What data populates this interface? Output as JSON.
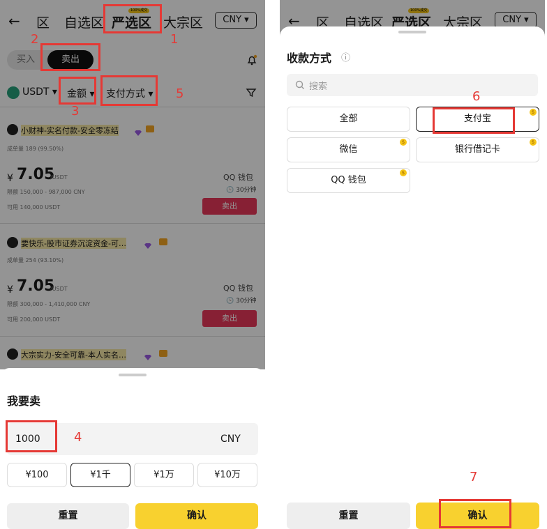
{
  "left": {
    "header": {
      "back": "←",
      "tab_partial": "区",
      "tab_self": "自选区",
      "tab_strict": "严选区",
      "tab_strict_badge": "100%成交",
      "tab_bulk": "大宗区",
      "currency": "CNY ▾"
    },
    "side": {
      "buy": "买入",
      "sell": "卖出"
    },
    "filters": {
      "coin": "USDT ▾",
      "amount": "金额 ▾",
      "payment": "支付方式 ▾"
    },
    "ads": [
      {
        "name": "小财神-实名付款-安全零冻结",
        "stats": "成单量 189 (99.50%)",
        "currency_symbol": "¥",
        "price": "7.05",
        "unit": "/USDT",
        "limit": "限额 150,000 - 987,000 CNY",
        "available": "可用 140,000 USDT",
        "pay": "QQ 钱包",
        "time": "30分钟",
        "action": "卖出"
      },
      {
        "name": "要快乐-股市证券沉淀资金-可…",
        "stats": "成单量 254 (93.10%)",
        "currency_symbol": "¥",
        "price": "7.05",
        "unit": "/USDT",
        "limit": "限额 300,000 - 1,410,000 CNY",
        "available": "可用 200,000 USDT",
        "pay": "QQ 钱包",
        "time": "30分钟",
        "action": "卖出"
      },
      {
        "name": "大宗实力-安全可靠-本人实名…"
      }
    ],
    "sheet": {
      "title": "我要卖",
      "amount": "1000",
      "currency": "CNY",
      "presets": [
        "¥100",
        "¥1千",
        "¥1万",
        "¥10万"
      ],
      "reset": "重置",
      "confirm": "确认"
    },
    "annotations": [
      "1",
      "2",
      "3",
      "4",
      "5"
    ]
  },
  "right": {
    "header": {
      "back": "←",
      "tab_partial": "区",
      "tab_self": "自选区",
      "tab_strict": "严选区",
      "tab_strict_badge": "100%成交",
      "tab_bulk": "大宗区",
      "currency": "CNY ▾"
    },
    "sheet": {
      "title": "收款方式",
      "info": "ⓘ",
      "search_placeholder": "搜索",
      "options": [
        "全部",
        "支付宝",
        "微信",
        "银行借记卡",
        "QQ 钱包"
      ],
      "reset": "重置",
      "confirm": "确认"
    },
    "annotations": [
      "6",
      "7"
    ]
  },
  "colors": {
    "accent_yellow": "#f8d12f",
    "annotation_red": "#e53935",
    "sell_red": "#e8385a",
    "bg_dim": "rgba(0,0,0,0.42)"
  }
}
